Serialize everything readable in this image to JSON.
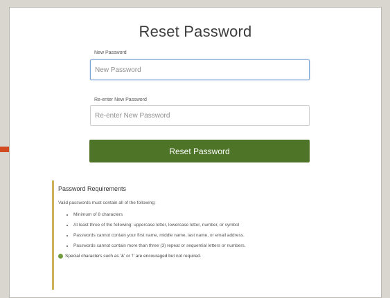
{
  "page": {
    "title": "Reset Password"
  },
  "form": {
    "new_password": {
      "label": "New Password",
      "placeholder": "New Password",
      "value": ""
    },
    "reenter_password": {
      "label": "Re-enter New Password",
      "placeholder": "Re-enter New Password",
      "value": ""
    },
    "submit_label": "Reset Password"
  },
  "requirements": {
    "title": "Password Requirements",
    "intro": "Valid passwords must contain all of the following:",
    "items": [
      "Minimum of 8 characters",
      "At least three of the following: uppercase letter, lowercase letter, number, or symbol",
      "Passwords cannot contain your first name, middle name, last name, or email address.",
      "Passwords cannot contain more than three (3) repeat or sequential letters or numbers."
    ],
    "note": "Special characters such as '&' or '!' are encouraged but not required."
  },
  "colors": {
    "button": "#4e7428",
    "arrow": "#d24a1f",
    "requirements_border": "#c9b25a"
  },
  "icons": {
    "annotation_arrow": "right-arrow-icon",
    "note_bullet": "green-dot-icon"
  }
}
